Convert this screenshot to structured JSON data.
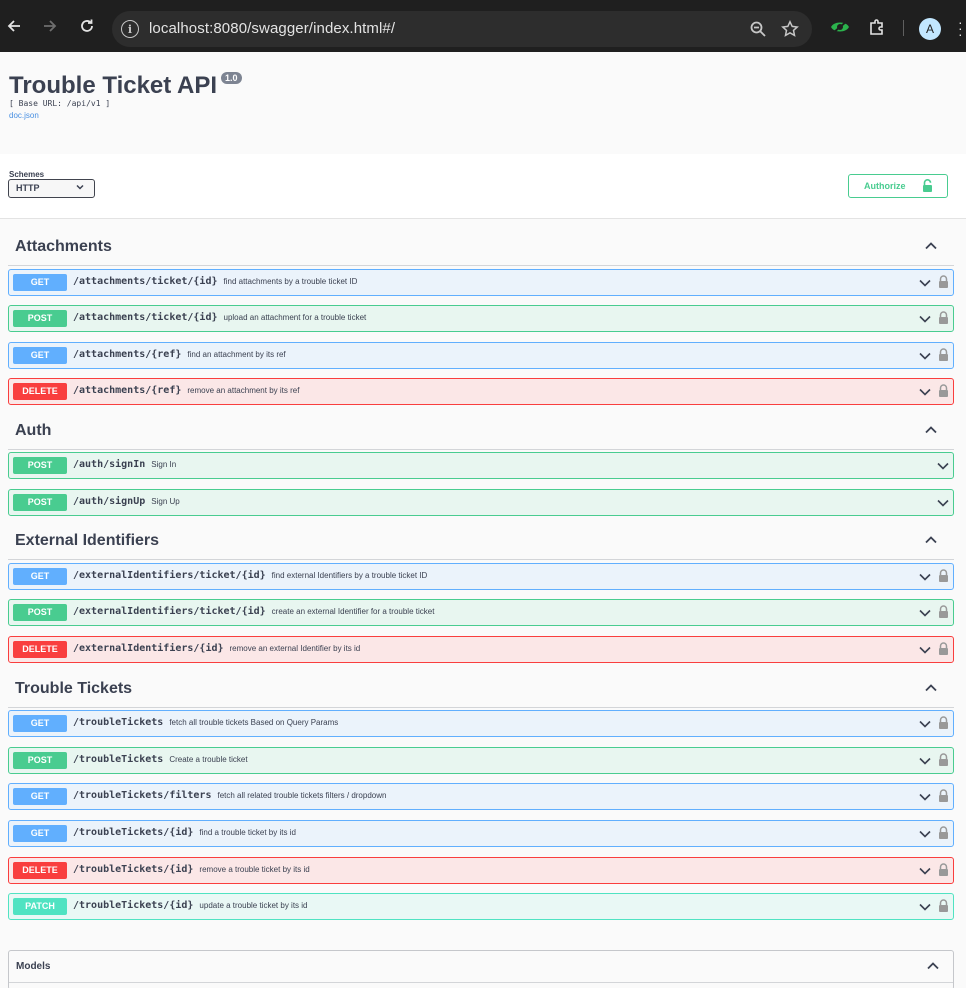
{
  "browser": {
    "url": "localhost:8080/swagger/index.html#/",
    "avatar_letter": "A",
    "back_icon": "arrow-left-icon",
    "forward_icon": "arrow-right-icon",
    "reload_icon": "reload-icon"
  },
  "info": {
    "title": "Trouble Ticket API",
    "version": "1.0",
    "base_url": "[ Base URL: /api/v1 ]",
    "doc_link": "doc.json"
  },
  "schemes": {
    "label": "Schemes",
    "selected": "HTTP"
  },
  "authorize_label": "Authorize",
  "colors": {
    "get": "#61affe",
    "post": "#49cc90",
    "delete": "#f93e3e",
    "patch": "#50e3c2"
  },
  "tags": [
    {
      "name": "Attachments",
      "operations": [
        {
          "method": "GET",
          "path": "/attachments/ticket/{id}",
          "summary": "find attachments by a trouble ticket ID"
        },
        {
          "method": "POST",
          "path": "/attachments/ticket/{id}",
          "summary": "upload an attachment for a trouble ticket"
        },
        {
          "method": "GET",
          "path": "/attachments/{ref}",
          "summary": "find an attachment by its ref"
        },
        {
          "method": "DELETE",
          "path": "/attachments/{ref}",
          "summary": "remove an attachment by its ref"
        }
      ]
    },
    {
      "name": "Auth",
      "operations": [
        {
          "method": "POST",
          "path": "/auth/signIn",
          "summary": "Sign In"
        },
        {
          "method": "POST",
          "path": "/auth/signUp",
          "summary": "Sign Up"
        }
      ]
    },
    {
      "name": "External Identifiers",
      "operations": [
        {
          "method": "GET",
          "path": "/externalIdentifiers/ticket/{id}",
          "summary": "find external Identifiers by a trouble ticket ID"
        },
        {
          "method": "POST",
          "path": "/externalIdentifiers/ticket/{id}",
          "summary": "create an external Identifier for a trouble ticket"
        },
        {
          "method": "DELETE",
          "path": "/externalIdentifiers/{id}",
          "summary": "remove an external Identifier by its id"
        }
      ]
    },
    {
      "name": "Trouble Tickets",
      "operations": [
        {
          "method": "GET",
          "path": "/troubleTickets",
          "summary": "fetch all trouble tickets Based on Query Params"
        },
        {
          "method": "POST",
          "path": "/troubleTickets",
          "summary": "Create a trouble ticket"
        },
        {
          "method": "GET",
          "path": "/troubleTickets/filters",
          "summary": "fetch all related trouble tickets filters / dropdown"
        },
        {
          "method": "GET",
          "path": "/troubleTickets/{id}",
          "summary": "find a trouble ticket by its id"
        },
        {
          "method": "DELETE",
          "path": "/troubleTickets/{id}",
          "summary": "remove a trouble ticket by its id"
        },
        {
          "method": "PATCH",
          "path": "/troubleTickets/{id}",
          "summary": "update a trouble ticket by its id"
        }
      ]
    }
  ],
  "models_title": "Models"
}
